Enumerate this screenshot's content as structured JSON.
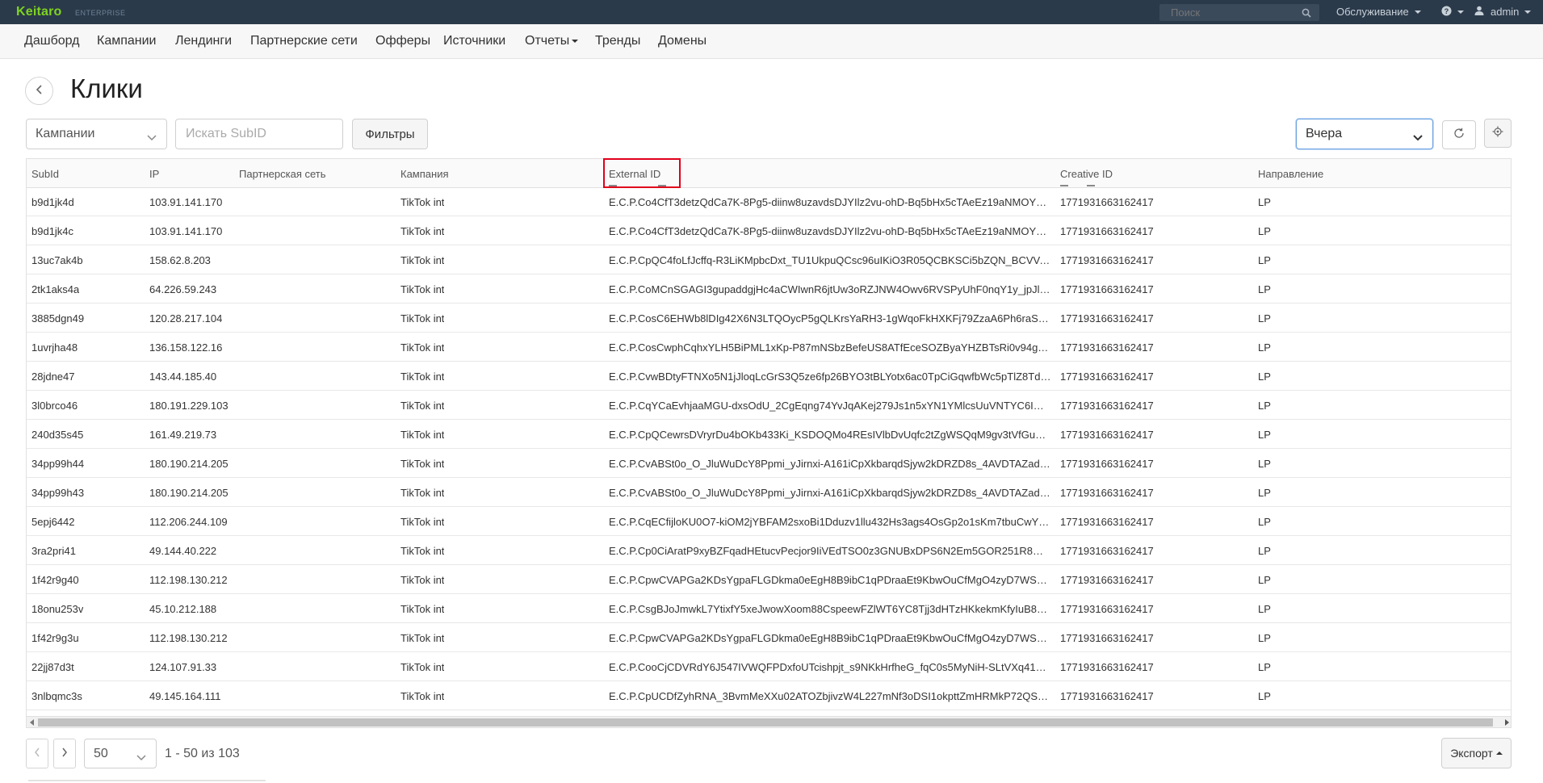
{
  "topbar": {
    "brand": "Keitaro",
    "edition": "ENTERPRISE",
    "search_placeholder": "Поиск",
    "service_menu": "Обслуживание",
    "help_icon": "question-circle-icon",
    "user": "admin"
  },
  "nav": {
    "items": [
      "Дашборд",
      "Кампании",
      "Лендинги",
      "Партнерские сети",
      "Офферы",
      "Источники",
      "Отчеты",
      "Тренды",
      "Домены"
    ]
  },
  "page": {
    "title": "Клики"
  },
  "filters": {
    "campaigns_select": "Кампании",
    "subid_placeholder": "Искать SubID",
    "filters_button": "Фильтры",
    "date_range": "Вчера"
  },
  "table": {
    "headers": [
      "SubId",
      "IP",
      "Партнерская сеть",
      "Кампания",
      "External ID",
      "Creative ID",
      "Направление"
    ],
    "rows": [
      [
        "b9d1jk4d",
        "103.91.141.170",
        "",
        "TikTok int",
        "E.C.P.Co4CfT3detzQdCa7K-8Pg5-diinw8uzavdsDJYIlz2vu-ohD-Bq5bHx5cTAeEz19aNMOYgX…",
        "1771931663162417",
        "LP"
      ],
      [
        "b9d1jk4c",
        "103.91.141.170",
        "",
        "TikTok int",
        "E.C.P.Co4CfT3detzQdCa7K-8Pg5-diinw8uzavdsDJYIlz2vu-ohD-Bq5bHx5cTAeEz19aNMOYgX…",
        "1771931663162417",
        "LP"
      ],
      [
        "13uc7ak4b",
        "158.62.8.203",
        "",
        "TikTok int",
        "E.C.P.CpQC4foLfJcffq-R3LiKMpbcDxt_TU1UkpuQCsc96uIKiO3R05QCBKSCi5bZQN_BCVVawr…",
        "1771931663162417",
        "LP"
      ],
      [
        "2tk1aks4a",
        "64.226.59.243",
        "",
        "TikTok int",
        "E.C.P.CoMCnSGAGI3gupaddgjHc4aCWIwnR6jtUw3oRZJNW4Owv6RVSPyUhF0nqY1y_jpJlzHc…",
        "1771931663162417",
        "LP"
      ],
      [
        "3885dgn49",
        "120.28.217.104",
        "",
        "TikTok int",
        "E.C.P.CosC6EHWb8lDIg42X6N3LTQOycP5gQLKrsYaRH3-1gWqoFkHXKFj79ZzaA6Ph6raSNM…",
        "1771931663162417",
        "LP"
      ],
      [
        "1uvrjha48",
        "136.158.122.16",
        "",
        "TikTok int",
        "E.C.P.CosCwphCqhxYLH5BiPML1xKp-P87mNSbzBefeUS8ATfEceSOZByaYHZBTsRi0v94gvbU…",
        "1771931663162417",
        "LP"
      ],
      [
        "28jdne47",
        "143.44.185.40",
        "",
        "TikTok int",
        "E.C.P.CvwBDtyFTNXo5N1jJloqLcGrS3Q5ze6fp26BYO3tBLYotx6ac0TpCiGqwfbWc5pTlZ8TdYS…",
        "1771931663162417",
        "LP"
      ],
      [
        "3l0brco46",
        "180.191.229.103",
        "",
        "TikTok int",
        "E.C.P.CqYCaEvhjaaMGU-dxsOdU_2CgEqng74YvJqAKej279Js1n5xYN1YMlcsUuVNTYC6IDA8…",
        "1771931663162417",
        "LP"
      ],
      [
        "240d35s45",
        "161.49.219.73",
        "",
        "TikTok int",
        "E.C.P.CpQCewrsDVryrDu4bOKb433Ki_KSDOQMo4REsIVlbDvUqfc2tZgWSQqM9gv3tVfGu7Vg…",
        "1771931663162417",
        "LP"
      ],
      [
        "34pp99h44",
        "180.190.214.205",
        "",
        "TikTok int",
        "E.C.P.CvABSt0o_O_JluWuDcY8Ppmi_yJirnxi-A161iCpXkbarqdSjyw2kDRZD8s_4AVDTAZad48E…",
        "1771931663162417",
        "LP"
      ],
      [
        "34pp99h43",
        "180.190.214.205",
        "",
        "TikTok int",
        "E.C.P.CvABSt0o_O_JluWuDcY8Ppmi_yJirnxi-A161iCpXkbarqdSjyw2kDRZD8s_4AVDTAZad48E…",
        "1771931663162417",
        "LP"
      ],
      [
        "5epj6442",
        "112.206.244.109",
        "",
        "TikTok int",
        "E.C.P.CqECfijloKU0O7-kiOM2jYBFAM2sxoBi1Dduzv1llu432Hs3ags4OsGp2o1sKm7tbuCwYDc…",
        "1771931663162417",
        "LP"
      ],
      [
        "3ra2pri41",
        "49.144.40.222",
        "",
        "TikTok int",
        "E.C.P.Cp0CiAratP9xyBZFqadHEtucvPecjor9IiVEdTSO0z3GNUBxDPS6N2Em5GOR251R8QO27…",
        "1771931663162417",
        "LP"
      ],
      [
        "1f42r9g40",
        "112.198.130.212",
        "",
        "TikTok int",
        "E.C.P.CpwCVAPGa2KDsYgpaFLGDkma0eEgH8B9ibC1qPDraaEt9KbwOuCfMgO4zyD7WSF5jlF…",
        "1771931663162417",
        "LP"
      ],
      [
        "18onu253v",
        "45.10.212.188",
        "",
        "TikTok int",
        "E.C.P.CsgBJoJmwkL7YtixfY5xeJwowXoom88CspeewFZlWT6YC8Tjj3dHTzHKkekmKfyIuB8p…",
        "1771931663162417",
        "LP"
      ],
      [
        "1f42r9g3u",
        "112.198.130.212",
        "",
        "TikTok int",
        "E.C.P.CpwCVAPGa2KDsYgpaFLGDkma0eEgH8B9ibC1qPDraaEt9KbwOuCfMgO4zyD7WSF5jlF…",
        "1771931663162417",
        "LP"
      ],
      [
        "22jj87d3t",
        "124.107.91.33",
        "",
        "TikTok int",
        "E.C.P.CooCjCDVRdY6J547IVWQFPDxfoUTcishpjt_s9NKkHrfheG_fqC0s5MyNiH-SLtVXq419In…",
        "1771931663162417",
        "LP"
      ],
      [
        "3nlbqmc3s",
        "49.145.164.111",
        "",
        "TikTok int",
        "E.C.P.CpUCDfZyhRNA_3BvmMeXXu02ATOZbjivzW4L227mNf3oDSI1okpttZmHRMkP72QSucz…",
        "1771931663162417",
        "LP"
      ]
    ]
  },
  "footer": {
    "per_page": "50",
    "pager_info": "1 - 50 из 103",
    "export_button": "Экспорт"
  }
}
